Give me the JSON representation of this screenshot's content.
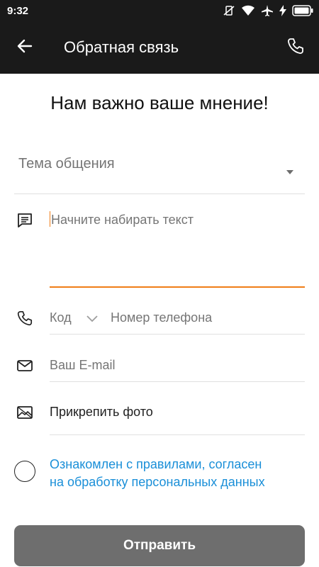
{
  "status_bar": {
    "time": "9:32",
    "icons": [
      "vibrate-off-icon",
      "wifi-icon",
      "airplane-icon",
      "charging-icon",
      "battery-icon"
    ]
  },
  "app_bar": {
    "title": "Обратная связь",
    "back_icon": "arrow-back-icon",
    "call_icon": "phone-icon",
    "background": "#1a1a1a"
  },
  "form": {
    "headline": "Нам важно ваше мнение!",
    "topic": {
      "placeholder": "Тема общения"
    },
    "message": {
      "placeholder": "Начните набирать текст",
      "accent": "#f07d17"
    },
    "phone": {
      "code_label": "Код",
      "number_placeholder": "Номер телефона"
    },
    "email": {
      "placeholder": "Ваш E-mail"
    },
    "photo": {
      "label": "Прикрепить фото"
    },
    "consent": {
      "line1": "Ознакомлен с правилами, согласен",
      "line2": "на обработку персональных данных",
      "checked": false,
      "link_color": "#1a8fd8"
    },
    "submit": {
      "label": "Отправить",
      "color": "#6e6e6e"
    }
  }
}
